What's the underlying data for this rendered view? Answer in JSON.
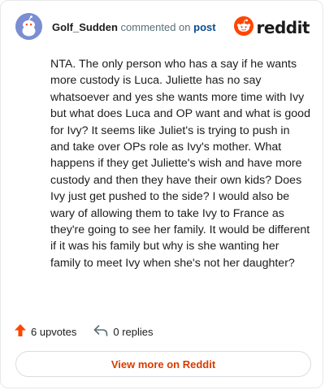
{
  "comment": {
    "author": "Golf_Sudden",
    "action_text": "commented on",
    "post_link_label": "post",
    "body": "NTA. The only person who has a say if he wants more custody is Luca. Juliette has no say whatsoever and yes she wants more time with Ivy but what does Luca and OP want and what is good for Ivy? It seems like Juliet's is trying to push in and take over OPs role as Ivy's mother. What happens if they get Juliette's wish and have more custody and then they have their own kids? Does Ivy just get pushed to the side? I would also be wary of allowing them to take Ivy to France as they're going to see her family. It would be different if it was his family but why is she wanting her family to meet Ivy when she's not her daughter?",
    "upvotes_label": "6 upvotes",
    "replies_label": "0 replies"
  },
  "brand": {
    "wordmark": "reddit",
    "icon": "reddit-snoo-icon",
    "color": "#ff4500"
  },
  "avatar": {
    "icon": "snoo-avatar-icon",
    "color": "#7b8ed3"
  },
  "icons": {
    "upvote": "upvote-arrow-icon",
    "reply": "reply-arrow-icon"
  },
  "cta": {
    "label": "View more on Reddit",
    "color": "#d93a00"
  }
}
